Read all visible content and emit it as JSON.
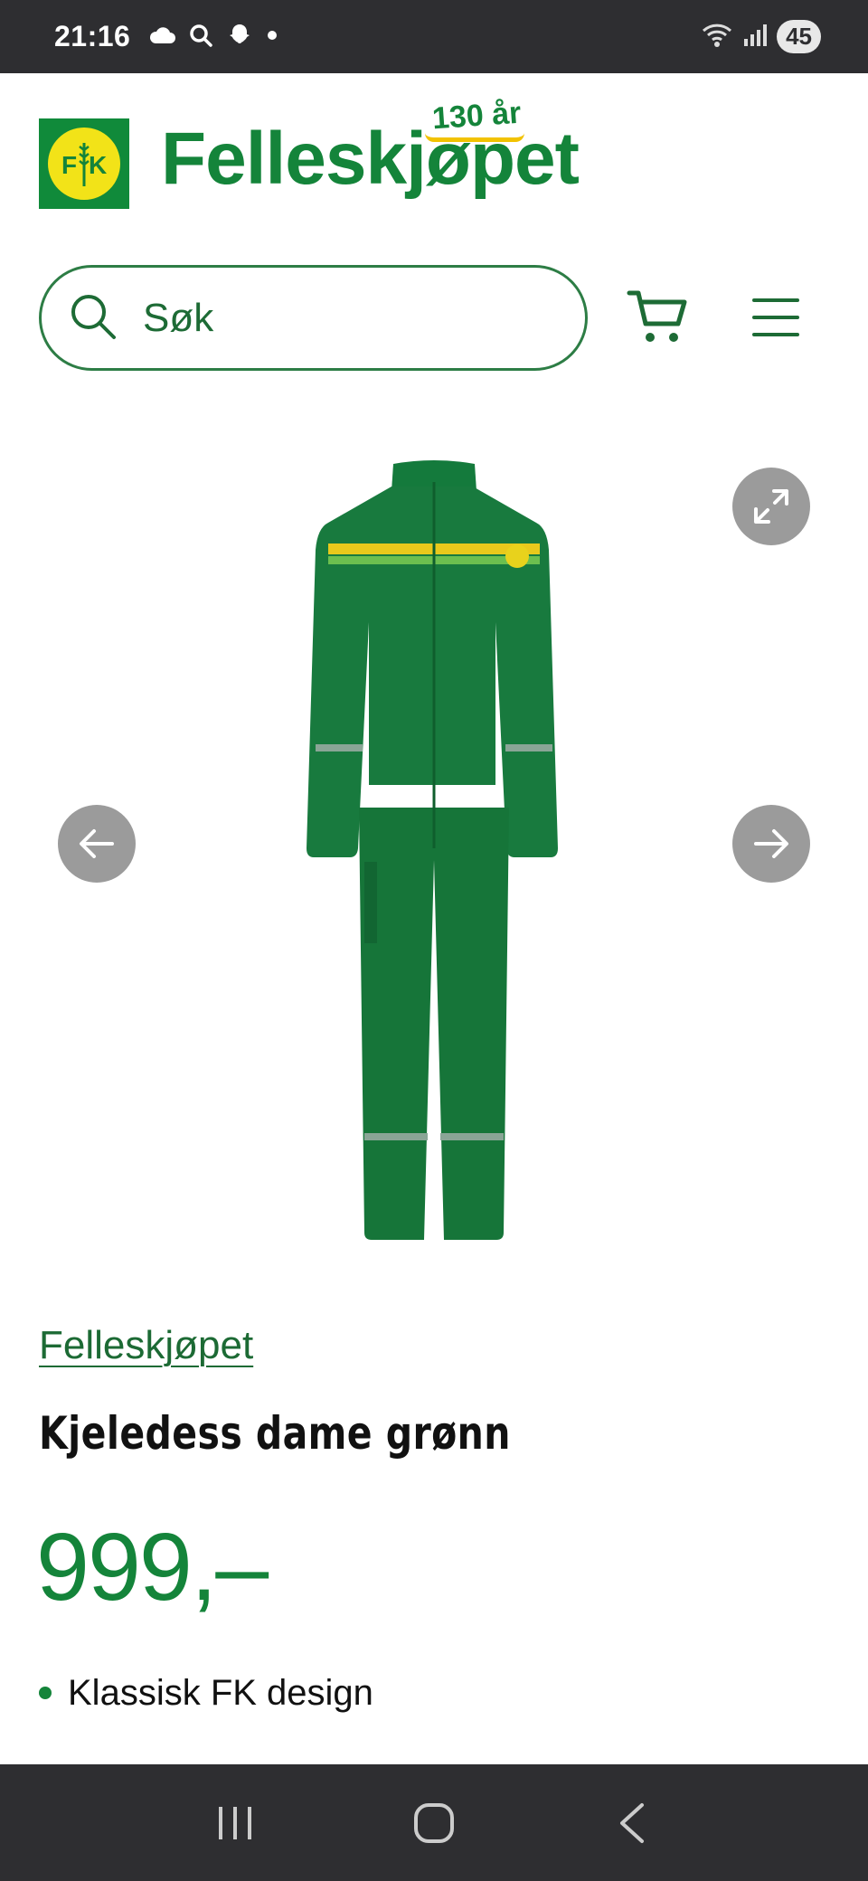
{
  "status_bar": {
    "time": "21:16",
    "battery": "45",
    "icons_left": [
      "cloud-icon",
      "search-icon",
      "snapchat-icon",
      "dot-icon"
    ],
    "icons_right": [
      "wifi-icon",
      "signal-icon",
      "battery-icon"
    ]
  },
  "header": {
    "logo_letters": "FK",
    "brand_name": "Felleskjøpet",
    "anniversary": "130 år",
    "brand_color": "#14843a",
    "accent_color": "#f2e318"
  },
  "search": {
    "placeholder": "Søk",
    "icon": "search-icon"
  },
  "actions": {
    "cart_icon": "cart-icon",
    "menu_icon": "hamburger-menu-icon"
  },
  "gallery": {
    "expand_icon": "expand-icon",
    "prev_icon": "arrow-left-icon",
    "next_icon": "arrow-right-icon",
    "image_alt": "Kjeledess dame grønn"
  },
  "product": {
    "brand": "Felleskjøpet",
    "title": "Kjeledess dame grønn",
    "price": "999,–",
    "features": [
      "Klassisk FK design"
    ]
  },
  "nav_bar": {
    "icons": [
      "recent-apps-icon",
      "home-icon",
      "back-icon"
    ]
  }
}
